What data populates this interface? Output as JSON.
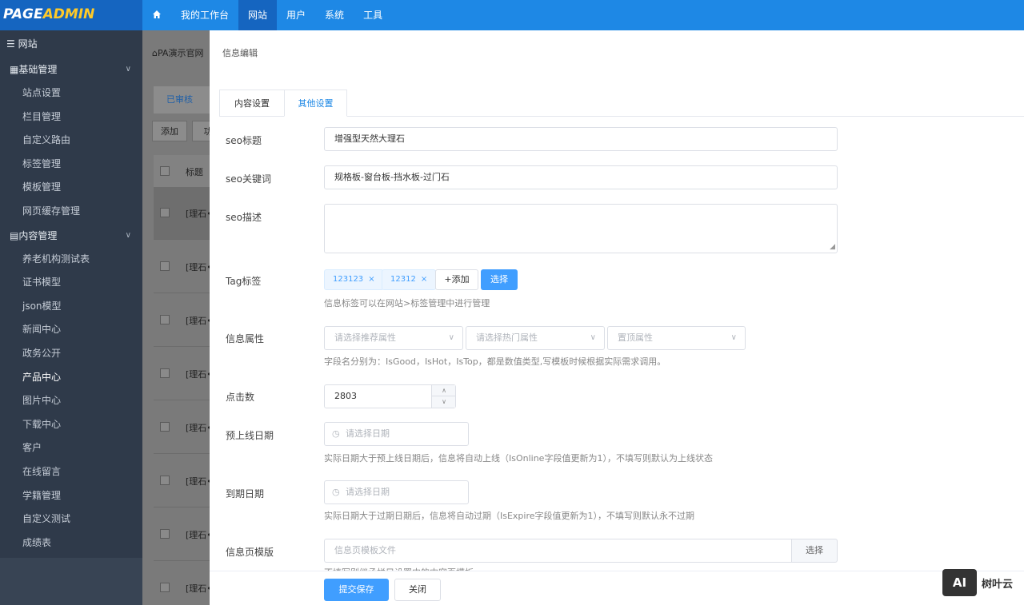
{
  "logo": {
    "text_main": "PAGE",
    "text_accent": "ADMIN"
  },
  "nav": {
    "home_icon": "home-icon",
    "items": [
      "我的工作台",
      "网站",
      "用户",
      "系统",
      "工具"
    ]
  },
  "sidebar": {
    "title": "网站",
    "group1": "基础管理",
    "group1_items": [
      "站点设置",
      "栏目管理",
      "自定义路由",
      "标签管理",
      "模板管理",
      "网页缓存管理"
    ],
    "group2": "内容管理",
    "group2_items": [
      "养老机构测试表",
      "证书模型",
      "json模型",
      "新闻中心",
      "政务公开",
      "产品中心",
      "图片中心",
      "下载中心",
      "客户",
      "在线留言",
      "学籍管理",
      "自定义测试",
      "成绩表"
    ],
    "active_item": "产品中心"
  },
  "background": {
    "breadcrumb": "PA演示官网",
    "tab": "已审核",
    "buttons": [
      "添加",
      "功"
    ],
    "header_col": "标题",
    "row_text": "[理石•"
  },
  "drawer": {
    "title": "信息编辑",
    "tabs": [
      "内容设置",
      "其他设置"
    ],
    "active_tab": "其他设置",
    "seo_title_label": "seo标题",
    "seo_title_value": "增强型天然大理石",
    "seo_keywords_label": "seo关键词",
    "seo_keywords_value": "规格板-窗台板-挡水板-过门石",
    "seo_desc_label": "seo描述",
    "tag_label": "Tag标签",
    "tags": [
      "123123",
      "12312"
    ],
    "tag_add": "+添加",
    "tag_pick": "选择",
    "tag_help": "信息标签可以在网站>标签管理中进行管理",
    "attr_label": "信息属性",
    "attr_selects": [
      "请选择推荐属性",
      "请选择热门属性",
      "置顶属性"
    ],
    "attr_help": "字段名分别为：IsGood，IsHot，IsTop，都是数值类型,写模板时候根据实际需求调用。",
    "clicks_label": "点击数",
    "clicks_value": "2803",
    "online_label": "预上线日期",
    "online_placeholder": "请选择日期",
    "online_help": "实际日期大于预上线日期后，信息将自动上线（IsOnline字段值更新为1），不填写则默认为上线状态",
    "expire_label": "到期日期",
    "expire_placeholder": "请选择日期",
    "expire_help": "实际日期大于过期日期后，信息将自动过期（IsExpire字段值更新为1），不填写则默认永不过期",
    "template_label": "信息页模版",
    "template_placeholder": "信息页模板文件",
    "template_pick": "选择",
    "template_help": "不填写则继承栏目设置中的内容页模板",
    "save_button": "提交保存",
    "close_button": "关闭"
  },
  "watermark": {
    "box": "AI",
    "text": "树叶云"
  }
}
